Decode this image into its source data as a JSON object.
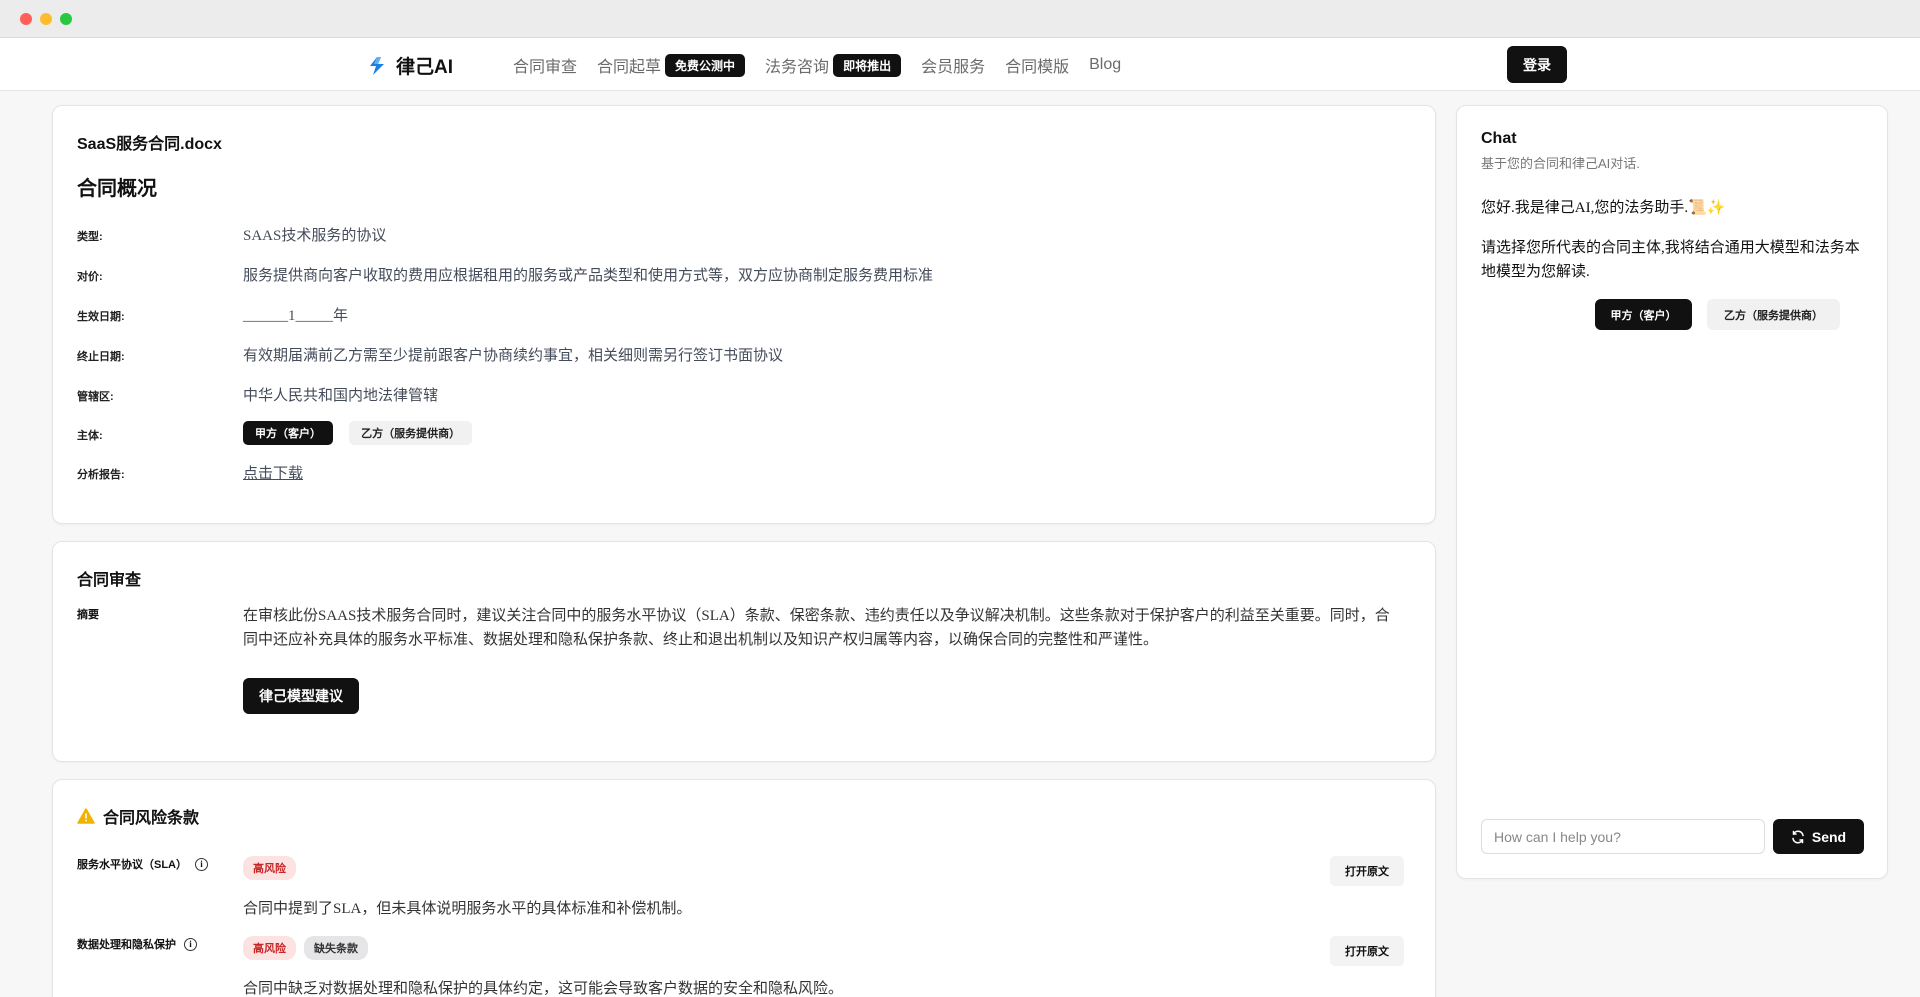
{
  "nav": {
    "logo_text": "律己AI",
    "items": [
      {
        "label": "合同审查",
        "badge": null
      },
      {
        "label": "合同起草",
        "badge": "免费公测中"
      },
      {
        "label": "法务咨询",
        "badge": "即将推出"
      },
      {
        "label": "会员服务",
        "badge": null
      },
      {
        "label": "合同模版",
        "badge": null
      },
      {
        "label": "Blog",
        "badge": null
      }
    ],
    "login_label": "登录"
  },
  "overview": {
    "file_name": "SaaS服务合同.docx",
    "title": "合同概况",
    "rows": {
      "type": {
        "label": "类型:",
        "value": "SAAS技术服务的协议"
      },
      "price": {
        "label": "对价:",
        "value": "服务提供商向客户收取的费用应根据租用的服务或产品类型和使用方式等，双方应协商制定服务费用标准"
      },
      "start": {
        "label": "生效日期:",
        "value": "______1_____年"
      },
      "end": {
        "label": "终止日期:",
        "value": "有效期届满前乙方需至少提前跟客户协商续约事宜，相关细则需另行签订书面协议"
      },
      "jurisdiction": {
        "label": "管辖区:",
        "value": "中华人民共和国内地法律管辖"
      },
      "parties": {
        "label": "主体:",
        "party_a": "甲方（客户）",
        "party_b": "乙方（服务提供商）"
      },
      "report": {
        "label": "分析报告:",
        "link": "点击下载"
      }
    }
  },
  "review": {
    "title": "合同审查",
    "summary_label": "摘要",
    "summary_text": "在审核此份SAAS技术服务合同时，建议关注合同中的服务水平协议（SLA）条款、保密条款、违约责任以及争议解决机制。这些条款对于保护客户的利益至关重要。同时，合同中还应补充具体的服务水平标准、数据处理和隐私保护条款、终止和退出机制以及知识产权归属等内容，以确保合同的完整性和严谨性。",
    "advice_button": "律己模型建议"
  },
  "risk": {
    "title": "合同风险条款",
    "items": [
      {
        "name": "服务水平协议（SLA）",
        "tags": [
          "高风险"
        ],
        "open_label": "打开原文",
        "desc": "合同中提到了SLA，但未具体说明服务水平的具体标准和补偿机制。"
      },
      {
        "name": "数据处理和隐私保护",
        "tags": [
          "高风险",
          "缺失条款"
        ],
        "open_label": "打开原文",
        "desc": "合同中缺乏对数据处理和隐私保护的具体约定，这可能会导致客户数据的安全和隐私风险。"
      }
    ]
  },
  "chat": {
    "title": "Chat",
    "subtitle": "基于您的合同和律己AI对话.",
    "greeting": "您好.我是律己AI,您的法务助手.📜✨",
    "prompt": "请选择您所代表的合同主体,我将结合通用大模型和法务本地模型为您解读.",
    "choice_a": "甲方（客户）",
    "choice_b": "乙方（服务提供商）",
    "input_placeholder": "How can I help you?",
    "send_label": "Send"
  },
  "colors": {
    "accent": "#111111",
    "logo_blue": "#1e7fe0",
    "risk_red": "#c62828",
    "warning": "#f2b200"
  }
}
